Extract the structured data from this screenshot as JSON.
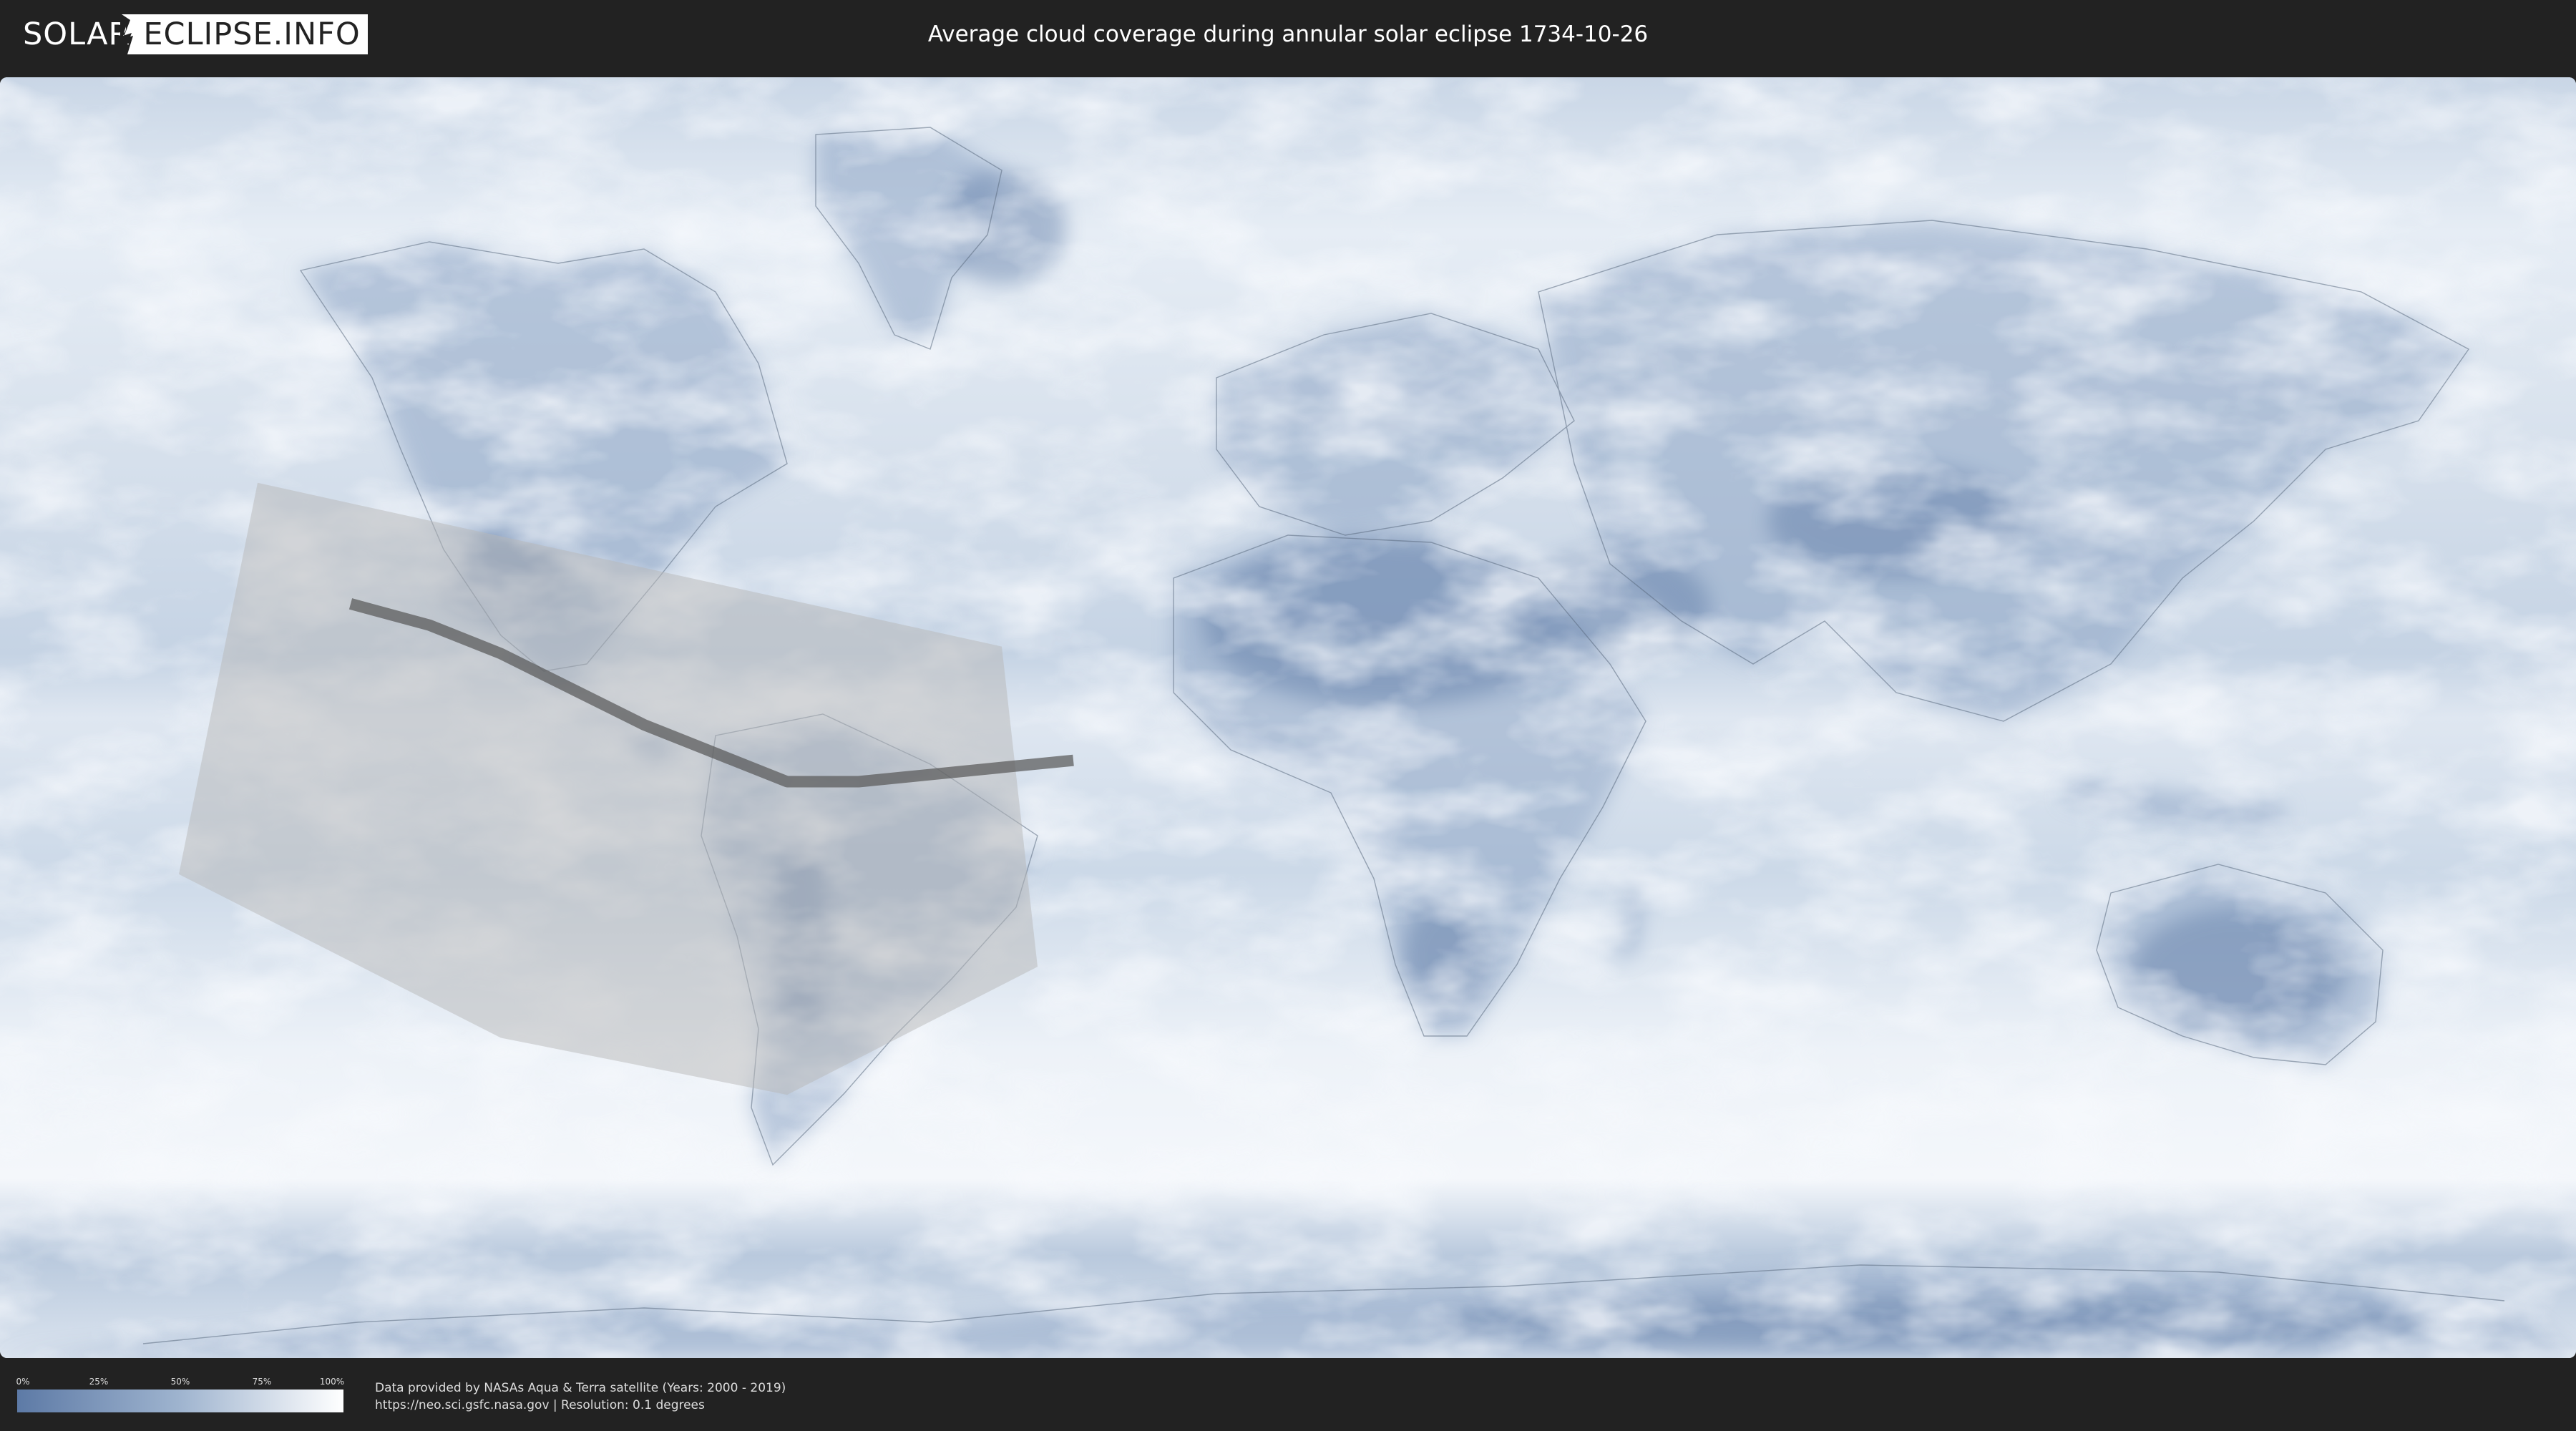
{
  "header": {
    "logo_left": "SOLAR",
    "logo_right": "ECLIPSE.INFO",
    "title": "Average cloud coverage during annular solar eclipse 1734-10-26"
  },
  "legend": {
    "ticks": [
      "0%",
      "25%",
      "50%",
      "75%",
      "100%"
    ],
    "gradient_colors": [
      "#5d7aa6",
      "#9fb4cf",
      "#ffffff"
    ]
  },
  "footer": {
    "credit_line_1": "Data provided by NASAs Aqua & Terra satellite (Years: 2000 - 2019)",
    "credit_line_2": "https://neo.sci.gsfc.nasa.gov | Resolution: 0.1 degrees"
  },
  "map": {
    "projection": "equirectangular",
    "colors": {
      "clear_sky": "#5d7aa6",
      "cloudy": "#ffffff",
      "eclipse_zone": "#b8b8b8",
      "central_path": "#555555",
      "coastline": "#5b6b80"
    },
    "eclipse_central_path": [
      [
        -131,
        16
      ],
      [
        -120,
        13
      ],
      [
        -110,
        9
      ],
      [
        -100,
        4
      ],
      [
        -90,
        -1
      ],
      [
        -80,
        -5
      ],
      [
        -70,
        -9
      ],
      [
        -60,
        -9
      ],
      [
        -50,
        -8
      ],
      [
        -40,
        -7
      ],
      [
        -30,
        -6
      ]
    ],
    "eclipse_zone_polygon": [
      [
        -144,
        33
      ],
      [
        -40,
        10
      ],
      [
        -35,
        -35
      ],
      [
        -70,
        -53
      ],
      [
        -110,
        -45
      ],
      [
        -155,
        -22
      ]
    ]
  }
}
